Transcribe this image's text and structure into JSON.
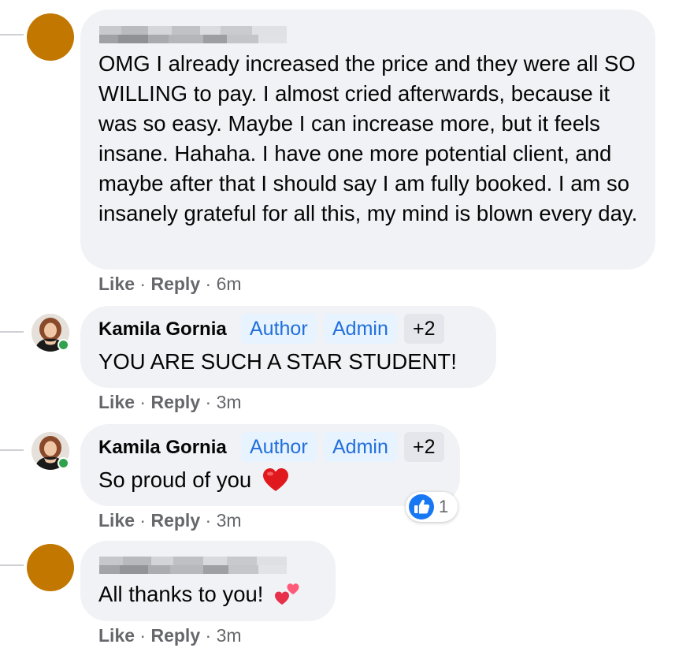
{
  "comments": [
    {
      "author": "",
      "text": "OMG I already increased the price and they were all SO WILLING to pay. I almost cried afterwards, because it was so easy. Maybe I can increase more, but it feels insane. Hahaha. I have one more potential client, and maybe after that I should say I am fully booked. I am so insanely grateful for all this, my mind is blown every day.",
      "actions": {
        "like": "Like",
        "reply": "Reply",
        "time": "6m"
      }
    },
    {
      "author": "Kamila Gornia",
      "badges": [
        "Author",
        "Admin",
        "+2"
      ],
      "text": "YOU ARE SUCH A STAR STUDENT!",
      "actions": {
        "like": "Like",
        "reply": "Reply",
        "time": "3m"
      }
    },
    {
      "author": "Kamila Gornia",
      "badges": [
        "Author",
        "Admin",
        "+2"
      ],
      "text": "So proud of you",
      "emoji": "red-heart",
      "reaction": {
        "icon": "like-thumb-icon",
        "count": "1"
      },
      "actions": {
        "like": "Like",
        "reply": "Reply",
        "time": "3m"
      }
    },
    {
      "author": "",
      "text": "All thanks to you!",
      "emoji": "two-hearts",
      "actions": {
        "like": "Like",
        "reply": "Reply",
        "time": "3m"
      }
    }
  ],
  "separator": "·",
  "colors": {
    "bubble": "#f0f2f5",
    "badge_blue": "#216fdb",
    "badge_blue_bg": "#e7f3ff",
    "avatar_orange": "#c27700",
    "online": "#31a24c",
    "meta": "#65676b"
  }
}
